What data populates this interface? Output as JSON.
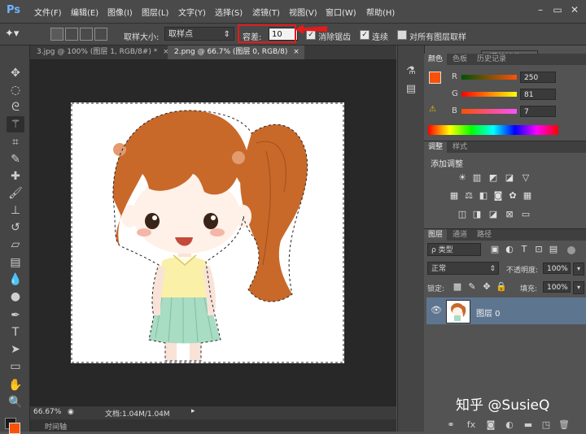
{
  "app": {
    "logo": "Ps"
  },
  "menu": [
    "文件(F)",
    "编辑(E)",
    "图像(I)",
    "图层(L)",
    "文字(Y)",
    "选择(S)",
    "滤镜(T)",
    "视图(V)",
    "窗口(W)",
    "帮助(H)"
  ],
  "window_buttons": [
    "–",
    "▭",
    "✕"
  ],
  "options": {
    "sample_size_label": "取样大小:",
    "sample_size_value": "取样点",
    "tolerance_label": "容差:",
    "tolerance_value": "10",
    "anti_alias_label": "消除锯齿",
    "contiguous_label": "连续",
    "sample_all_label": "对所有图层取样",
    "refine_edge_label": "调整边缘..."
  },
  "tabs": [
    {
      "label": "3.jpg @ 100% (图层 1, RGB/8#) *",
      "close": "×"
    },
    {
      "label": "2.png @ 66.7% (图层 0, RGB/8)",
      "close": "×"
    }
  ],
  "status": {
    "zoom": "66.67%",
    "doc_info": "文档:1.04M/1.04M"
  },
  "timeline": {
    "label": "时间轴"
  },
  "color_panel": {
    "tabs": [
      "颜色",
      "色板",
      "历史记录"
    ],
    "r_label": "R",
    "r_value": "250",
    "g_label": "G",
    "g_value": "81",
    "b_label": "B",
    "b_value": "7",
    "foreground": "#fa5107"
  },
  "adjust_panel": {
    "tabs": [
      "调整",
      "样式"
    ],
    "title": "添加调整"
  },
  "layers_panel": {
    "tabs": [
      "图层",
      "通道",
      "路径"
    ],
    "kind_label": "ρ 类型",
    "blend_mode": "正常",
    "opacity_label": "不透明度:",
    "opacity_value": "100%",
    "lock_label": "锁定:",
    "fill_label": "填充:",
    "fill_value": "100%",
    "layer_name": "图层 0"
  },
  "watermark": "知乎 @SusieQ"
}
